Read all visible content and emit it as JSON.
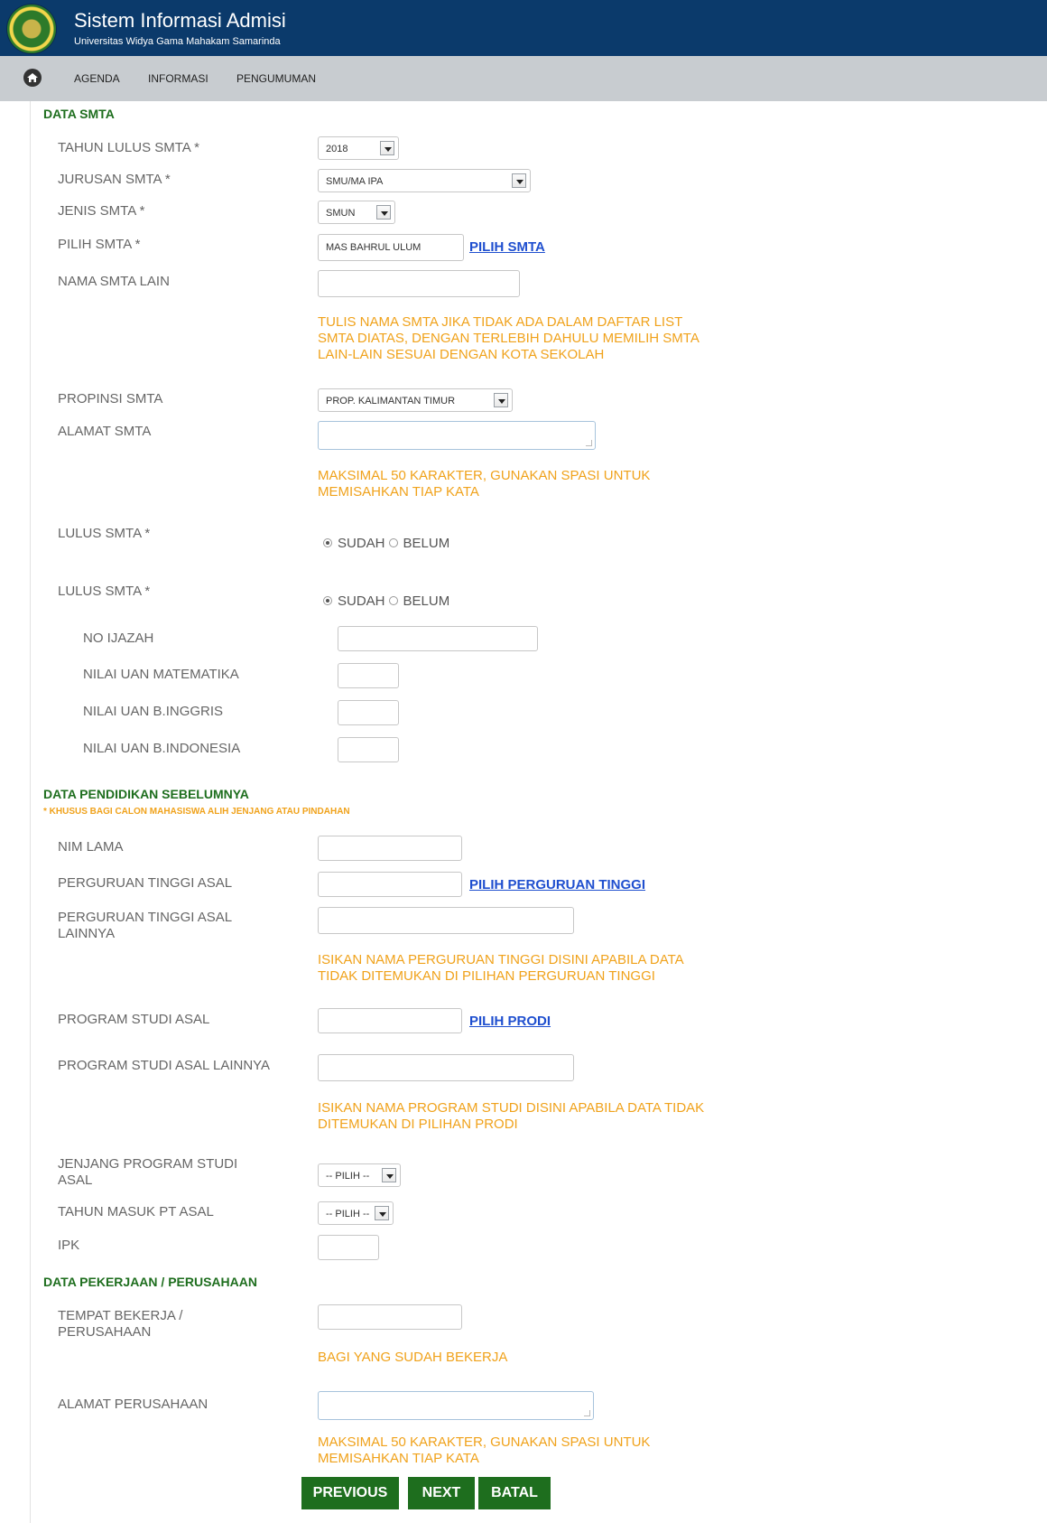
{
  "header": {
    "title": "Sistem Informasi Admisi",
    "subtitle": "Universitas Widya Gama Mahakam Samarinda"
  },
  "nav": {
    "items": [
      "AGENDA",
      "INFORMASI",
      "PENGUMUMAN"
    ]
  },
  "sections": {
    "data_smta": "DATA SMTA",
    "data_pendidikan": "DATA PENDIDIKAN SEBELUMNYA",
    "data_pendidikan_note": "* KHUSUS BAGI CALON MAHASISWA ALIH JENJANG ATAU PINDAHAN",
    "data_pekerjaan": "DATA PEKERJAAN / PERUSAHAAN"
  },
  "smta": {
    "tahun_lulus_label": "TAHUN LULUS SMTA *",
    "tahun_lulus_value": "2018",
    "jurusan_label": "JURUSAN SMTA *",
    "jurusan_value": "SMU/MA IPA",
    "jenis_label": "JENIS SMTA *",
    "jenis_value": "SMUN",
    "pilih_label": "PILIH SMTA *",
    "pilih_value": "MAS BAHRUL ULUM",
    "pilih_link": "PILIH SMTA",
    "nama_lain_label": "NAMA SMTA LAIN",
    "nama_lain_hint": "TULIS NAMA SMTA JIKA TIDAK ADA DALAM DAFTAR LIST\nSMTA DIATAS, DENGAN TERLEBIH DAHULU MEMILIH SMTA\nLAIN-LAIN SESUAI DENGAN KOTA SEKOLAH",
    "propinsi_label": "PROPINSI SMTA",
    "propinsi_value": "PROP. KALIMANTAN TIMUR",
    "alamat_label": "ALAMAT SMTA",
    "alamat_hint": "MAKSIMAL 50 KARAKTER, GUNAKAN SPASI UNTUK\nMEMISAHKAN TIAP KATA",
    "lulus_label": "LULUS SMTA *",
    "radio_sudah": "SUDAH",
    "radio_belum": "BELUM",
    "no_ijazah_label": "NO IJAZAH",
    "uan_mat_label": "NILAI UAN MATEMATIKA",
    "uan_ing_label": "NILAI UAN B.INGGRIS",
    "uan_ind_label": "NILAI UAN B.INDONESIA"
  },
  "pendidikan": {
    "nim_label": "NIM LAMA",
    "pt_label": "PERGURUAN TINGGI ASAL",
    "pt_link": "PILIH PERGURUAN TINGGI",
    "pt_lain_label": "PERGURUAN TINGGI ASAL\nLAINNYA",
    "pt_lain_hint": "ISIKAN NAMA PERGURUAN TINGGI DISINI APABILA DATA\nTIDAK DITEMUKAN DI PILIHAN PERGURUAN TINGGI",
    "prodi_label": "PROGRAM STUDI ASAL",
    "prodi_link": "PILIH PRODI",
    "prodi_lain_label": "PROGRAM STUDI ASAL LAINNYA",
    "prodi_lain_hint": "ISIKAN NAMA PROGRAM STUDI DISINI APABILA DATA TIDAK\nDITEMUKAN DI PILIHAN PRODI",
    "jenjang_label": "JENJANG PROGRAM STUDI\nASAL",
    "jenjang_value": "-- PILIH --",
    "tahun_masuk_label": "TAHUN MASUK PT ASAL",
    "tahun_masuk_value": "-- PILIH --",
    "ipk_label": "IPK"
  },
  "pekerjaan": {
    "tempat_label": "TEMPAT BEKERJA /\nPERUSAHAAN",
    "tempat_hint": "BAGI YANG SUDAH BEKERJA",
    "alamat_label": "ALAMAT PERUSAHAAN",
    "alamat_hint": "MAKSIMAL 50 KARAKTER, GUNAKAN SPASI UNTUK\nMEMISAHKAN TIAP KATA"
  },
  "buttons": {
    "previous": "PREVIOUS",
    "next": "NEXT",
    "batal": "BATAL"
  }
}
